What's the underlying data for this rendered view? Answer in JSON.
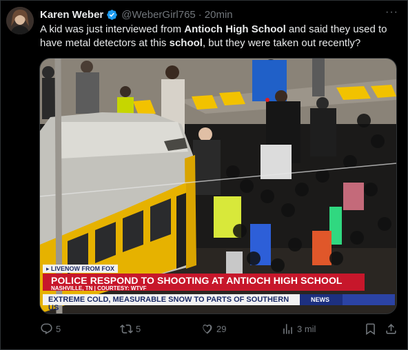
{
  "author": {
    "name": "Karen Weber",
    "handle": "@WeberGirl765",
    "separator": "·",
    "time": "20min"
  },
  "more_label": "···",
  "tweet": {
    "part1": "A kid was just interviewed from ",
    "bold1": "Antioch High School",
    "part2": " and said they used to have metal detectors at this ",
    "bold2": "school",
    "part3": ", but they were taken out recently?"
  },
  "video": {
    "live_tag": "LIVENOW FROM FOX",
    "headline": "POLICE RESPOND TO SHOOTING AT ANTIOCH HIGH SCHOOL",
    "subline": "NASHVILLE, TN | COURTESY: WTVF",
    "ticker": "EXTREME COLD, MEASURABLE SNOW TO PARTS OF SOUTHERN US",
    "news_tag": "NEWS"
  },
  "actions": {
    "replies": "5",
    "reposts": "5",
    "likes": "29",
    "views": "3 mil"
  },
  "colors": {
    "background": "#000000",
    "text": "#e7e9ea",
    "muted": "#71767b",
    "verified": "#1d9bf0",
    "headline_red": "#c7172b",
    "ticker_blue": "#1d3080"
  },
  "icons": [
    "verified-badge-icon",
    "more-icon",
    "reply-icon",
    "repost-icon",
    "like-icon",
    "views-icon",
    "bookmark-icon",
    "share-icon"
  ]
}
